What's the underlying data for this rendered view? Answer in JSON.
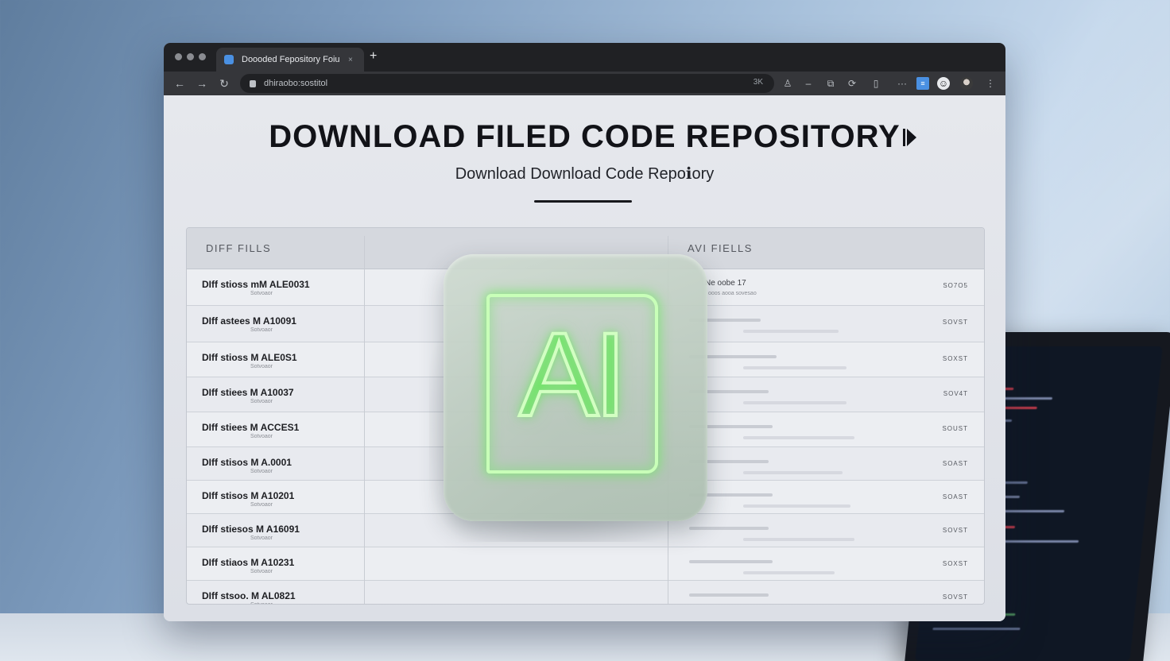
{
  "browser": {
    "tab_title": "Doooded Fepository Foiu",
    "tab_close": "×",
    "new_tab": "+",
    "url": "dhiraobo:sostitol",
    "omnibox_right": "3K"
  },
  "page": {
    "title": "DOWNLOAD FILED CODE REPOSITORY",
    "subtitle": "Download Download Code Repoℹory"
  },
  "table": {
    "headers": [
      "DIFF FILLS",
      "AVI FIELLS"
    ],
    "rows": [
      {
        "name": "DIff stioss mM ALE0031",
        "sub": "Sotvoaor",
        "meta": "Ne oobe 17",
        "meta_sub": "ooos aooa sovesao",
        "size": "SO7O5"
      },
      {
        "name": "DIff astees M A10091",
        "sub": "Sotvoaor",
        "meta": "",
        "meta_sub": "",
        "size": "SOVST"
      },
      {
        "name": "DIff stioss M ALE0S1",
        "sub": "Sotvoaor",
        "meta": "",
        "meta_sub": "",
        "size": "SOXST"
      },
      {
        "name": "DIff stiees M A10037",
        "sub": "Sotvoaor",
        "meta": "",
        "meta_sub": "",
        "size": "SOV4T"
      },
      {
        "name": "DIff stiees M ACCES1",
        "sub": "Sotvoaor",
        "meta": "",
        "meta_sub": "",
        "size": "SOUST"
      },
      {
        "name": "DIff stisos M A.0001",
        "sub": "Sotvoaor",
        "meta": "",
        "meta_sub": "",
        "size": "SOAST"
      },
      {
        "name": "DIff stisos M A10201",
        "sub": "Sotvoaor",
        "meta": "",
        "meta_sub": "",
        "size": "SOAST"
      },
      {
        "name": "DIff stiesos M A16091",
        "sub": "Sotvoaor",
        "meta": "",
        "meta_sub": "",
        "size": "SOVST"
      },
      {
        "name": "DIff stiaos M A10231",
        "sub": "Sotvoaor",
        "meta": "",
        "meta_sub": "",
        "size": "SOXST"
      },
      {
        "name": "DIff stsoo. M AL0821",
        "sub": "Sotvoaor",
        "meta": "",
        "meta_sub": "",
        "size": "SOVST"
      }
    ]
  },
  "overlay": {
    "ai_label": "AI",
    "glow_color": "#7be86a"
  }
}
